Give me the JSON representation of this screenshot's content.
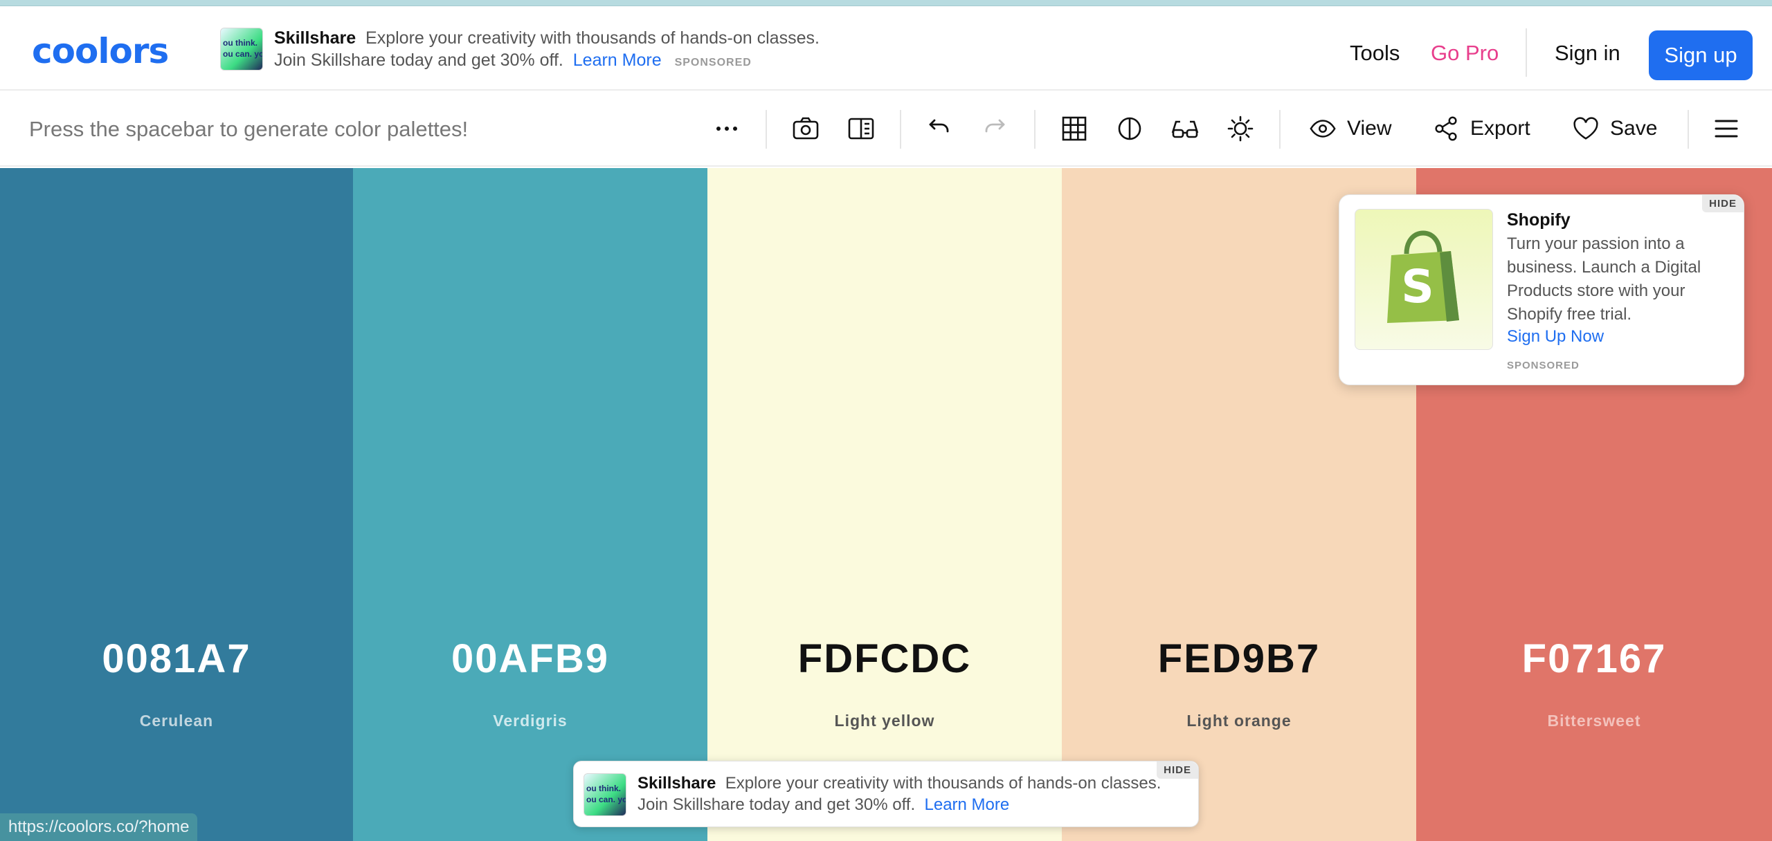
{
  "brand": {
    "logo_text": "coolors"
  },
  "header_ad": {
    "thumb_line1": "ou think.",
    "thumb_line2": "ou can. yo",
    "brand": "Skillshare",
    "text": "Explore your creativity with thousands of hands-on classes. Join Skillshare today and get 30% off.",
    "link": "Learn More",
    "sponsored": "SPONSORED"
  },
  "nav": {
    "tools": "Tools",
    "go_pro": "Go Pro",
    "sign_in": "Sign in",
    "sign_up": "Sign up"
  },
  "toolbar": {
    "hint": "Press the spacebar to generate color palettes!",
    "view": "View",
    "export": "Export",
    "save": "Save",
    "icons": [
      "more-icon",
      "camera-icon",
      "panel-icon",
      "undo-icon",
      "redo-icon",
      "grid-icon",
      "contrast-icon",
      "glasses-icon",
      "brightness-icon",
      "eye-icon",
      "share-icon",
      "heart-icon",
      "menu-icon"
    ]
  },
  "palette": [
    {
      "hex": "0081A7",
      "name": "Cerulean",
      "bg": "#327b9c",
      "fg": "#ffffff",
      "name_fg": "#c2d6df"
    },
    {
      "hex": "00AFB9",
      "name": "Verdigris",
      "bg": "#4baab8",
      "fg": "#ffffff",
      "name_fg": "#cfe9ed"
    },
    {
      "hex": "FDFCDC",
      "name": "Light yellow",
      "bg": "#fbfadd",
      "fg": "#111111",
      "name_fg": "#555555"
    },
    {
      "hex": "FED9B7",
      "name": "Light orange",
      "bg": "#f7d8b9",
      "fg": "#111111",
      "name_fg": "#555555"
    },
    {
      "hex": "F07167",
      "name": "Bittersweet",
      "bg": "#e07569",
      "fg": "#ffffff",
      "name_fg": "#f3c2bc"
    }
  ],
  "shopify_ad": {
    "title": "Shopify",
    "body": "Turn your passion into a business. Launch a Digital Products store with your Shopify free trial.",
    "link": "Sign Up Now",
    "sponsored": "SPONSORED",
    "hide": "HIDE"
  },
  "bottom_ad": {
    "brand": "Skillshare",
    "text": "Explore your creativity with thousands of hands-on classes. Join Skillshare today and get 30% off.",
    "link": "Learn More",
    "hide": "HIDE"
  },
  "status_bar": {
    "url": "https://coolors.co/?home"
  },
  "colors": {
    "accent": "#1f6ef0",
    "go_pro": "#e83e8c"
  }
}
